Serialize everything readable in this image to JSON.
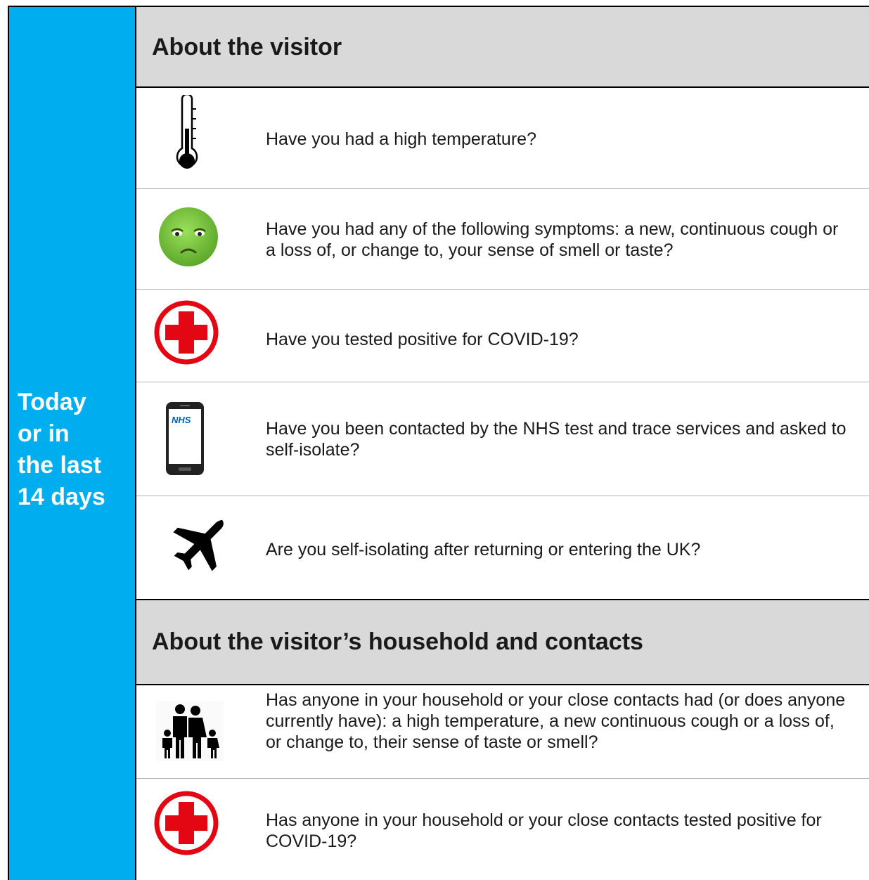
{
  "sidebar": {
    "label": "Today\nor in\nthe last\n14 days"
  },
  "section1": {
    "title": "About the visitor",
    "questions": [
      {
        "icon": "thermometer-icon",
        "text": "Have you had a high temperature?"
      },
      {
        "icon": "sick-face-icon",
        "text": "Have you had any of the following symptoms: a new, continuous cough or a loss of, or change to, your sense of smell or taste?"
      },
      {
        "icon": "red-cross-icon",
        "text": "Have you tested positive for COVID-19?"
      },
      {
        "icon": "nhs-phone-icon",
        "text": "Have you been contacted by the NHS test and trace services and asked to self-isolate?"
      },
      {
        "icon": "airplane-icon",
        "text": "Are you self-isolating after returning or entering the UK?"
      }
    ]
  },
  "section2": {
    "title": "About the visitor’s household and contacts",
    "questions": [
      {
        "icon": "family-icon",
        "text": "Has anyone in your household or your close contacts had (or does anyone currently have): a high temperature, a new continuous cough or a loss of, or change to, their sense of taste or smell?"
      },
      {
        "icon": "red-cross-icon",
        "text": "Has anyone in your household or your close contacts tested positive for COVID-19?"
      }
    ]
  },
  "phone_logo_text": "NHS",
  "colors": {
    "sidebar": "#00aeef",
    "header": "#d9d9d9",
    "cross": "#e30613",
    "face": "#7ac943"
  }
}
